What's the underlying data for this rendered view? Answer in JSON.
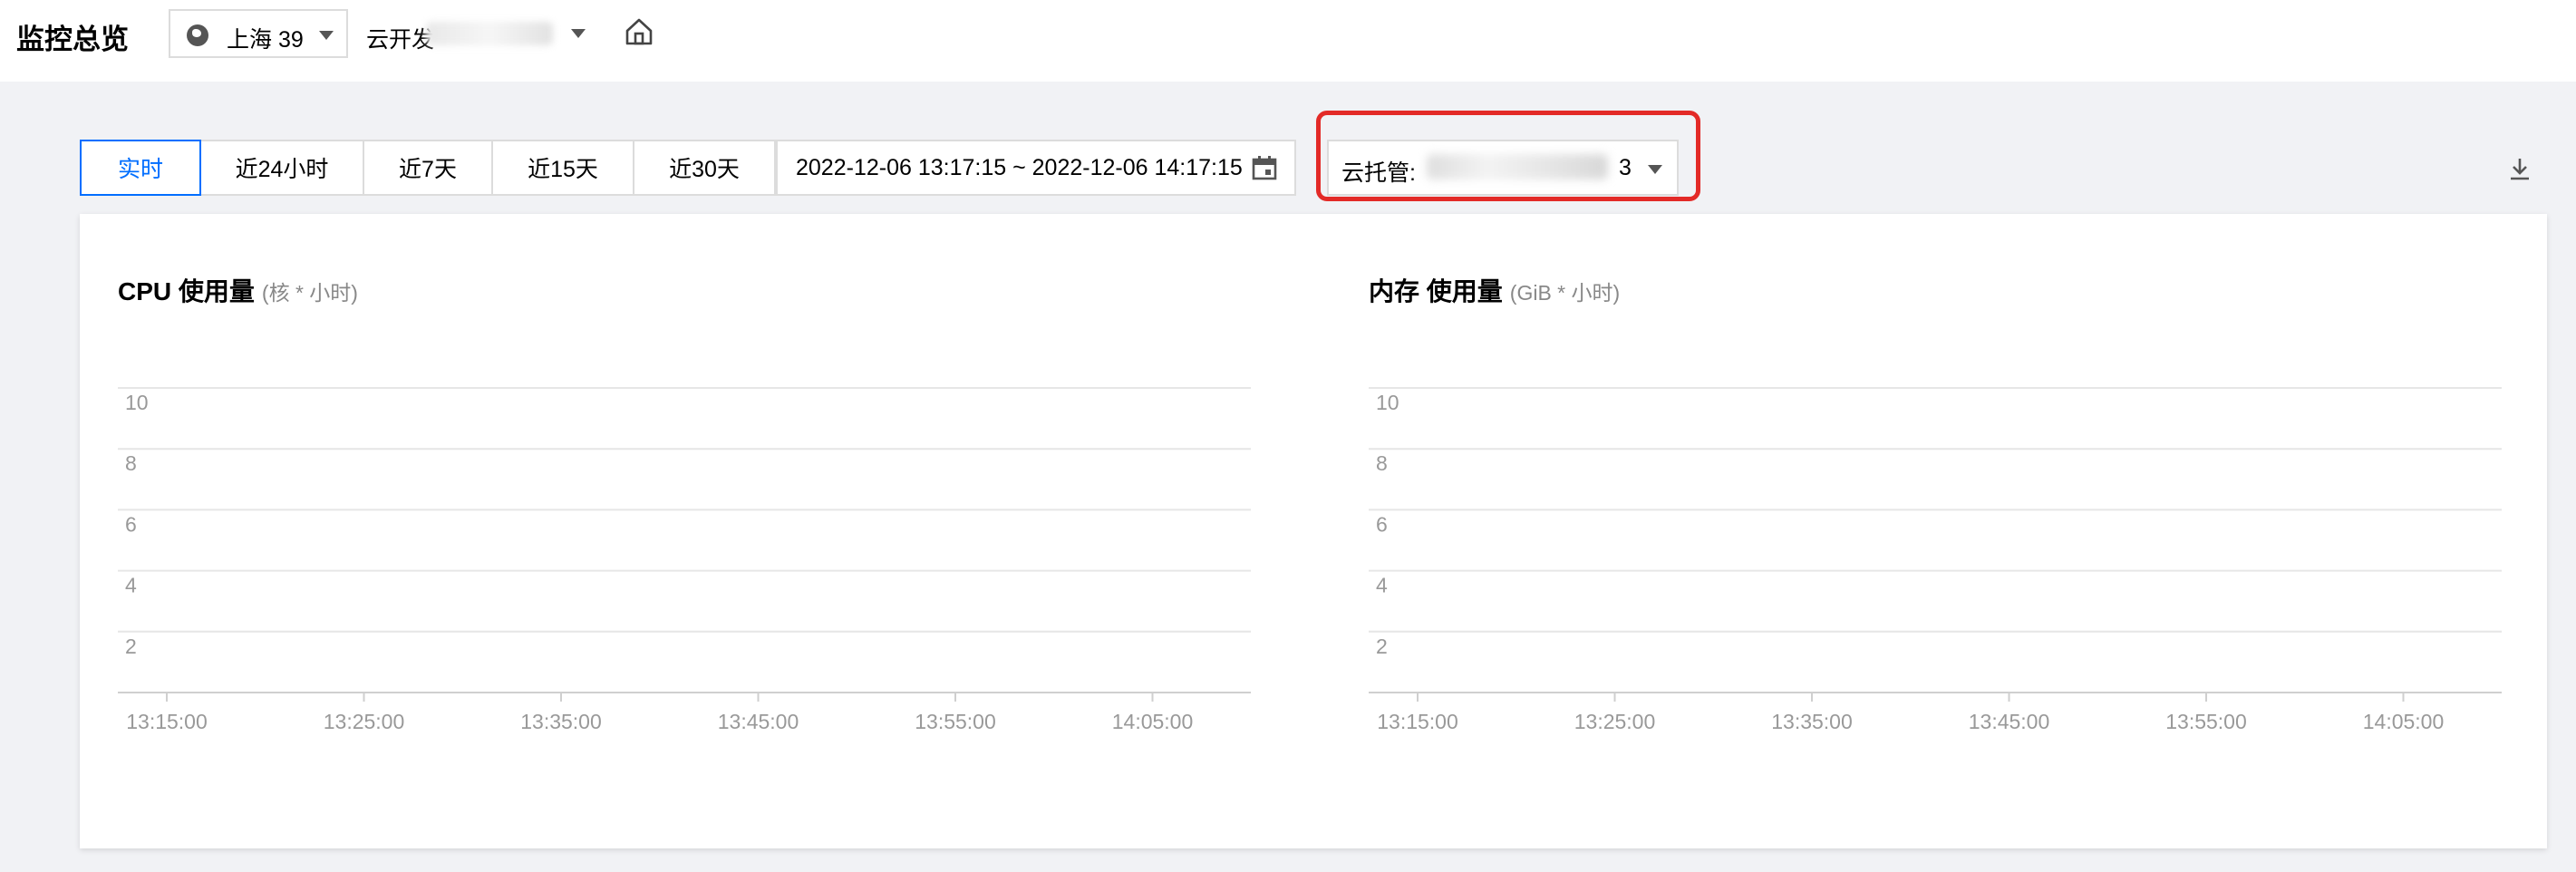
{
  "header": {
    "title": "监控总览",
    "region": "上海 39",
    "env_label": "云开发",
    "home_icon": "home-icon"
  },
  "toolbar": {
    "tabs": [
      {
        "label": "实时",
        "active": true
      },
      {
        "label": "近24小时",
        "active": false
      },
      {
        "label": "近7天",
        "active": false
      },
      {
        "label": "近15天",
        "active": false
      },
      {
        "label": "近30天",
        "active": false
      }
    ],
    "date_range": "2022-12-06 13:17:15 ~ 2022-12-06 14:17:15",
    "calendar_icon": "calendar-icon",
    "service_label": "云托管:",
    "service_suffix": "3",
    "download_icon": "download-icon",
    "highlight_color": "#e32a27",
    "accent_color": "#006eff"
  },
  "charts": [
    {
      "title": "CPU 使用量",
      "unit": "(核 * 小时)"
    },
    {
      "title": "内存 使用量",
      "unit": "(GiB * 小时)"
    }
  ],
  "chart_data": [
    {
      "type": "line",
      "title": "CPU 使用量",
      "ylabel": "(核 * 小时)",
      "xlabel": "",
      "x_ticks": [
        "13:15:00",
        "13:25:00",
        "13:35:00",
        "13:45:00",
        "13:55:00",
        "14:05:00"
      ],
      "y_ticks": [
        2,
        4,
        6,
        8,
        10
      ],
      "ylim": [
        0,
        10
      ],
      "grid": true,
      "series": []
    },
    {
      "type": "line",
      "title": "内存 使用量",
      "ylabel": "(GiB * 小时)",
      "xlabel": "",
      "x_ticks": [
        "13:15:00",
        "13:25:00",
        "13:35:00",
        "13:45:00",
        "13:55:00",
        "14:05:00"
      ],
      "y_ticks": [
        2,
        4,
        6,
        8,
        10
      ],
      "ylim": [
        0,
        10
      ],
      "grid": true,
      "series": []
    }
  ]
}
